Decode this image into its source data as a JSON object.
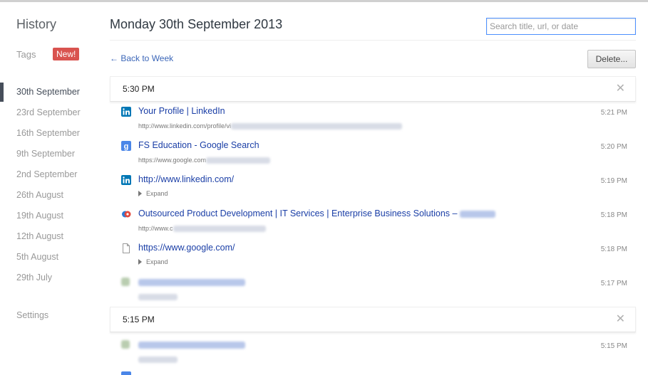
{
  "sidebar": {
    "title": "History",
    "tags_label": "Tags",
    "new_badge": "New!",
    "items": [
      {
        "label": "30th September"
      },
      {
        "label": "23rd September"
      },
      {
        "label": "16th September"
      },
      {
        "label": "9th September"
      },
      {
        "label": "2nd September"
      },
      {
        "label": "26th August"
      },
      {
        "label": "19th August"
      },
      {
        "label": "12th August"
      },
      {
        "label": "5th August"
      },
      {
        "label": "29th July"
      }
    ],
    "selected_index": 0,
    "settings_label": "Settings"
  },
  "main": {
    "title": "Monday 30th September 2013",
    "search_placeholder": "Search title, url, or date",
    "back_link": "← Back to Week",
    "delete_button": "Delete...",
    "close_glyph": "✕",
    "groups": [
      {
        "time": "5:30 PM",
        "entries": [
          {
            "icon": "linkedin-icon",
            "title": "Your Profile | LinkedIn",
            "url": "http://www.linkedin.com/profile/vi",
            "time": "5:21 PM"
          },
          {
            "icon": "google-icon",
            "title": "FS Education - Google Search",
            "url": "https://www.google.com",
            "time": "5:20 PM"
          },
          {
            "icon": "linkedin-icon",
            "title": "http://www.linkedin.com/",
            "expand": "Expand",
            "time": "5:19 PM"
          },
          {
            "icon": "site-logo-icon",
            "title": "Outsourced Product Development | IT Services | Enterprise Business Solutions –",
            "url": "http://www.c",
            "time": "5:18 PM"
          },
          {
            "icon": "page-icon",
            "title": "https://www.google.com/",
            "expand": "Expand",
            "time": "5:18 PM"
          },
          {
            "icon": "blurred-icon",
            "time": "5:17 PM"
          }
        ]
      },
      {
        "time": "5:15 PM",
        "entries": [
          {
            "icon": "blurred-icon",
            "time": "5:15 PM"
          }
        ]
      }
    ]
  },
  "colors": {
    "link": "#1a3ea6",
    "badge": "#d9534f",
    "linkedin": "#0077b5",
    "google": "#4a86e8"
  }
}
